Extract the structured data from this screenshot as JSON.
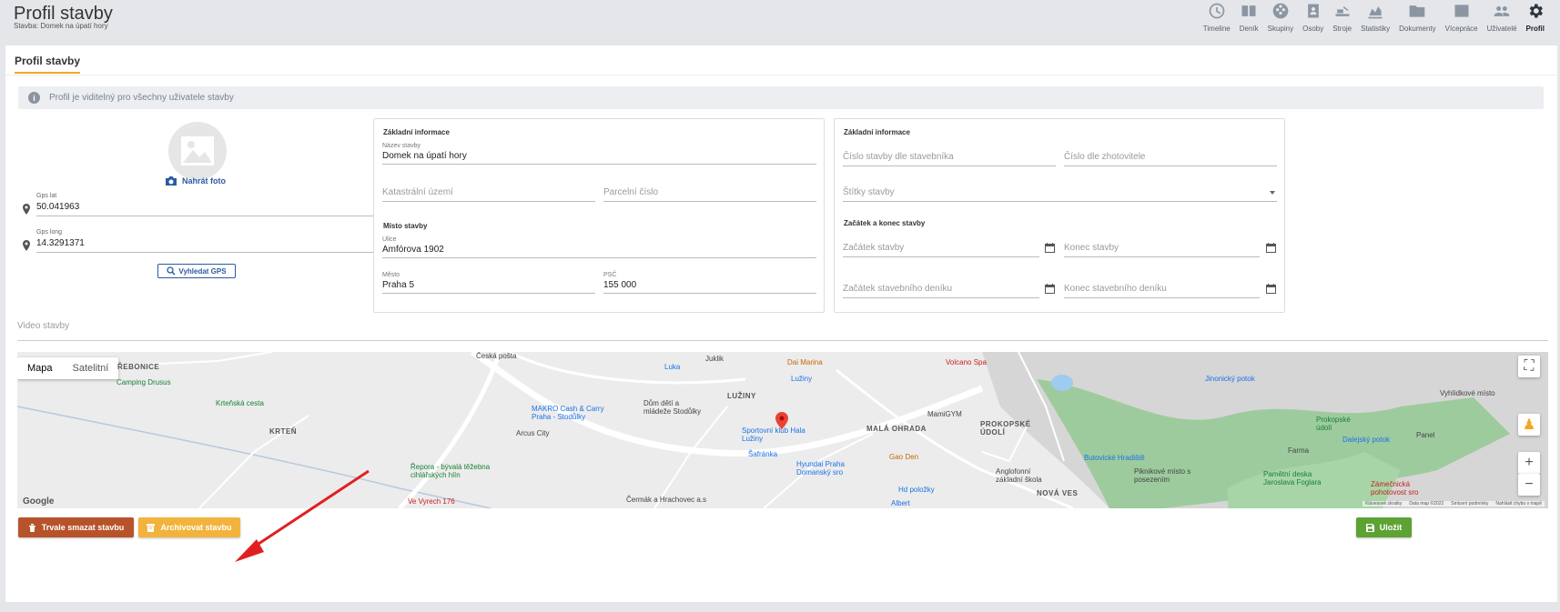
{
  "header": {
    "title": "Profil stavby",
    "subtitle": "Stavba: Domek na úpatí hory"
  },
  "nav": [
    {
      "label": "Timeline",
      "icon": "clock-icon"
    },
    {
      "label": "Deník",
      "icon": "book-icon"
    },
    {
      "label": "Skupiny",
      "icon": "groups-icon"
    },
    {
      "label": "Osoby",
      "icon": "person-badge-icon"
    },
    {
      "label": "Stroje",
      "icon": "machine-icon"
    },
    {
      "label": "Statistiky",
      "icon": "chart-icon"
    },
    {
      "label": "Dokumenty",
      "icon": "folder-icon"
    },
    {
      "label": "Vícepráce",
      "icon": "money-icon"
    },
    {
      "label": "Uživatelé",
      "icon": "users-icon"
    },
    {
      "label": "Profil",
      "icon": "gear-icon",
      "active": true
    }
  ],
  "tab_label": "Profil stavby",
  "info_text": "Profil je viditelný pro všechny uživatele stavby",
  "photo": {
    "upload_label": "Nahrát foto"
  },
  "gps": {
    "lat_label": "Gps lat",
    "lat_value": "50.041963",
    "long_label": "Gps long",
    "long_value": "14.3291371",
    "search_label": "Vyhledat GPS"
  },
  "basic_info": {
    "title": "Základní informace",
    "name_label": "Název stavby",
    "name_value": "Domek na úpatí hory",
    "cadastral_placeholder": "Katastrální území",
    "parcel_placeholder": "Parcelní číslo",
    "location_title": "Místo stavby",
    "street_label": "Ulice",
    "street_value": "Amfórova 1902",
    "city_label": "Město",
    "city_value": "Praha 5",
    "zip_label": "PSČ",
    "zip_value": "155 000"
  },
  "basic_info_2": {
    "title": "Základní informace",
    "investor_no_placeholder": "Číslo stavby dle stavebníka",
    "contractor_no_placeholder": "Číslo dle zhotovitele",
    "tags_placeholder": "Štítky stavby",
    "dates_title": "Začátek a konec stavby",
    "start_placeholder": "Začátek stavby",
    "end_placeholder": "Konec stavby",
    "diary_start_placeholder": "Začátek stavebního deníku",
    "diary_end_placeholder": "Konec stavebního deníku"
  },
  "video_placeholder": "Video stavby",
  "map": {
    "tab_map": "Mapa",
    "tab_satellite": "Satelitní",
    "labels": {
      "rebonice": "ŘEBONICE",
      "camping": "Camping Drusus",
      "krtenska": "Krteňská cesta",
      "kren": "KRTEŇ",
      "repora": "Řepora - bývalá těžebna cihlářských hlín",
      "vyrecha": "Ve Vyrech 176",
      "arcus": "Arcus City",
      "makro": "MAKRO Cash & Carry Praha - Stodůlky",
      "cesta_posta": "Česká pošta",
      "luka": "Luka",
      "juklik": "Juklik",
      "dum_deti": "Dům dětí a mládeže Stodůlky",
      "luziny": "LUŽINY",
      "sportovni": "Sportovní klub Hala Lužiny",
      "safranka": "Šafránka",
      "hyundai": "Hyundai Praha Domanský sro",
      "cermak": "Čermák a Hrachovec a.s",
      "dai_marina": "Dai Marina",
      "luziny_m": "Lužiny",
      "mala_ohrada": "MALÁ OHRADA",
      "mamigym": "MamiGYM",
      "gao_den": "Gao Den",
      "hd_polozky": "Hd položky",
      "albert": "Albert",
      "volcano": "Volcano Spa",
      "prokopske": "PROKOPSKÉ ÚDOLÍ",
      "anglofonni": "Anglofonní základní škola",
      "nova_ves": "NOVÁ VES",
      "butovicke": "Butovické Hradiště",
      "pikniko": "Piknikové místo s posezením",
      "pametni": "Pamětní deska Jaroslava Foglara",
      "zamecnicka": "Zámečnická pohotovost sro",
      "prokopske_udoli": "Prokopské údolí",
      "farma": "Farma",
      "panel": "Panel",
      "vyhlidkove": "Vyhlídkové místo",
      "jinonicky": "Jinonický potok",
      "dalejsky": "Dalejský potok"
    },
    "footer": [
      "Klávesové zkratky",
      "Data map ©2022",
      "Smluvní podmínky",
      "Nahlásit chybu v mapě"
    ],
    "google": "Google"
  },
  "buttons": {
    "delete": "Trvale smazat stavbu",
    "archive": "Archivovat stavbu",
    "save": "Uložit"
  },
  "colors": {
    "accent": "#f5a623",
    "primary_blue": "#2c5aa0",
    "delete": "#b7532a",
    "archive": "#f2b33d",
    "save": "#5da233",
    "arrow": "#e02020"
  }
}
